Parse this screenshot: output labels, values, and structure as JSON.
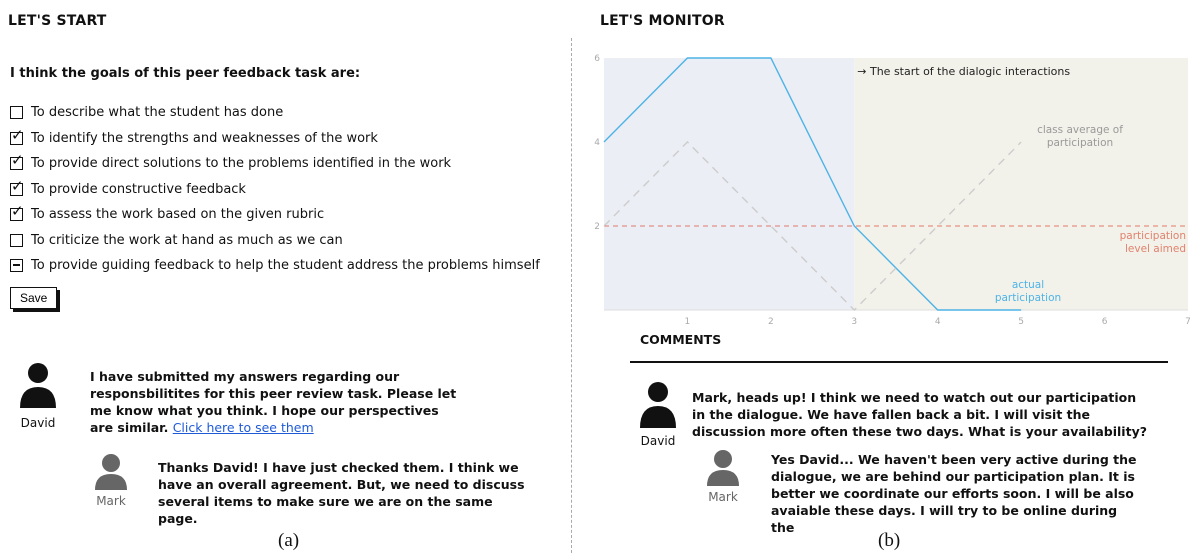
{
  "left": {
    "title": "LET'S START",
    "question": "I think the goals of this peer feedback task are:",
    "options": [
      {
        "label": "To describe what the student has done",
        "state": "unchecked"
      },
      {
        "label": "To identify the strengths and weaknesses of the work",
        "state": "checked"
      },
      {
        "label": "To provide direct solutions to the problems identified in the work",
        "state": "checked"
      },
      {
        "label": "To provide constructive feedback",
        "state": "checked"
      },
      {
        "label": "To assess the work based on the given rubric",
        "state": "checked"
      },
      {
        "label": "To criticize the work at hand as much as we can",
        "state": "unchecked"
      },
      {
        "label": "To provide guiding feedback to help the student address the problems himself",
        "state": "indeterminate"
      }
    ],
    "save_label": "Save",
    "messages": [
      {
        "author": "David",
        "text": "I have submitted my answers regarding our responsbilitites for this peer review task. Please let me know what you think. I hope our perspectives are similar.",
        "link": "Click here to see them"
      },
      {
        "author": "Mark",
        "text": "Thanks David! I have just checked them. I think we have an overall agreement. But, we need to discuss several items to make sure we are on the same page."
      }
    ],
    "caption": "(a)"
  },
  "right": {
    "title": "LET'S MONITOR",
    "comments_title": "COMMENTS",
    "messages": [
      {
        "author": "David",
        "text": "Mark, heads up! I think we need to watch out our participation in the dialogue. We have fallen back a bit. I will visit the discussion more often these two days. What is your availability?"
      },
      {
        "author": "Mark",
        "text": "Yes David... We haven't been very active during the dialogue, we are behind our participation plan. It is better we coordinate our efforts soon. I will be also avaiable these days. I will try to be online during the"
      }
    ],
    "caption": "(b)"
  },
  "chart_data": {
    "type": "line",
    "x": [
      0,
      1,
      2,
      3,
      4,
      5,
      6,
      7
    ],
    "xlim": [
      0,
      7
    ],
    "ylim": [
      0,
      6
    ],
    "x_ticks": [
      1,
      2,
      3,
      4,
      5,
      6,
      7
    ],
    "y_ticks": [
      2,
      4,
      6
    ],
    "series": [
      {
        "name": "actual participation",
        "points": [
          [
            0,
            4
          ],
          [
            1,
            6
          ],
          [
            2,
            6
          ],
          [
            3,
            2
          ],
          [
            4,
            0
          ],
          [
            5,
            0
          ]
        ],
        "color": "#4db3e6",
        "style": "solid"
      },
      {
        "name": "class average of participation",
        "points": [
          [
            0,
            2
          ],
          [
            1,
            4
          ],
          [
            2,
            2
          ],
          [
            3,
            0
          ],
          [
            4,
            2
          ],
          [
            5,
            4
          ]
        ],
        "color": "#cccccc",
        "style": "dashed"
      }
    ],
    "reference_line": {
      "name": "participation level aimed",
      "y": 2,
      "color": "#e07a6a"
    },
    "annotation": {
      "text": "→ The start of the dialogic interactions",
      "x": 3
    },
    "regions": [
      {
        "from": 0,
        "to": 3,
        "color": "#eceef5"
      },
      {
        "from": 3,
        "to": 7,
        "color": "#f3f2ea"
      }
    ],
    "labels": {
      "actual": [
        "actual",
        "participation"
      ],
      "average": [
        "class average of",
        "participation"
      ],
      "aimed": [
        "participation",
        "level aimed"
      ]
    }
  }
}
